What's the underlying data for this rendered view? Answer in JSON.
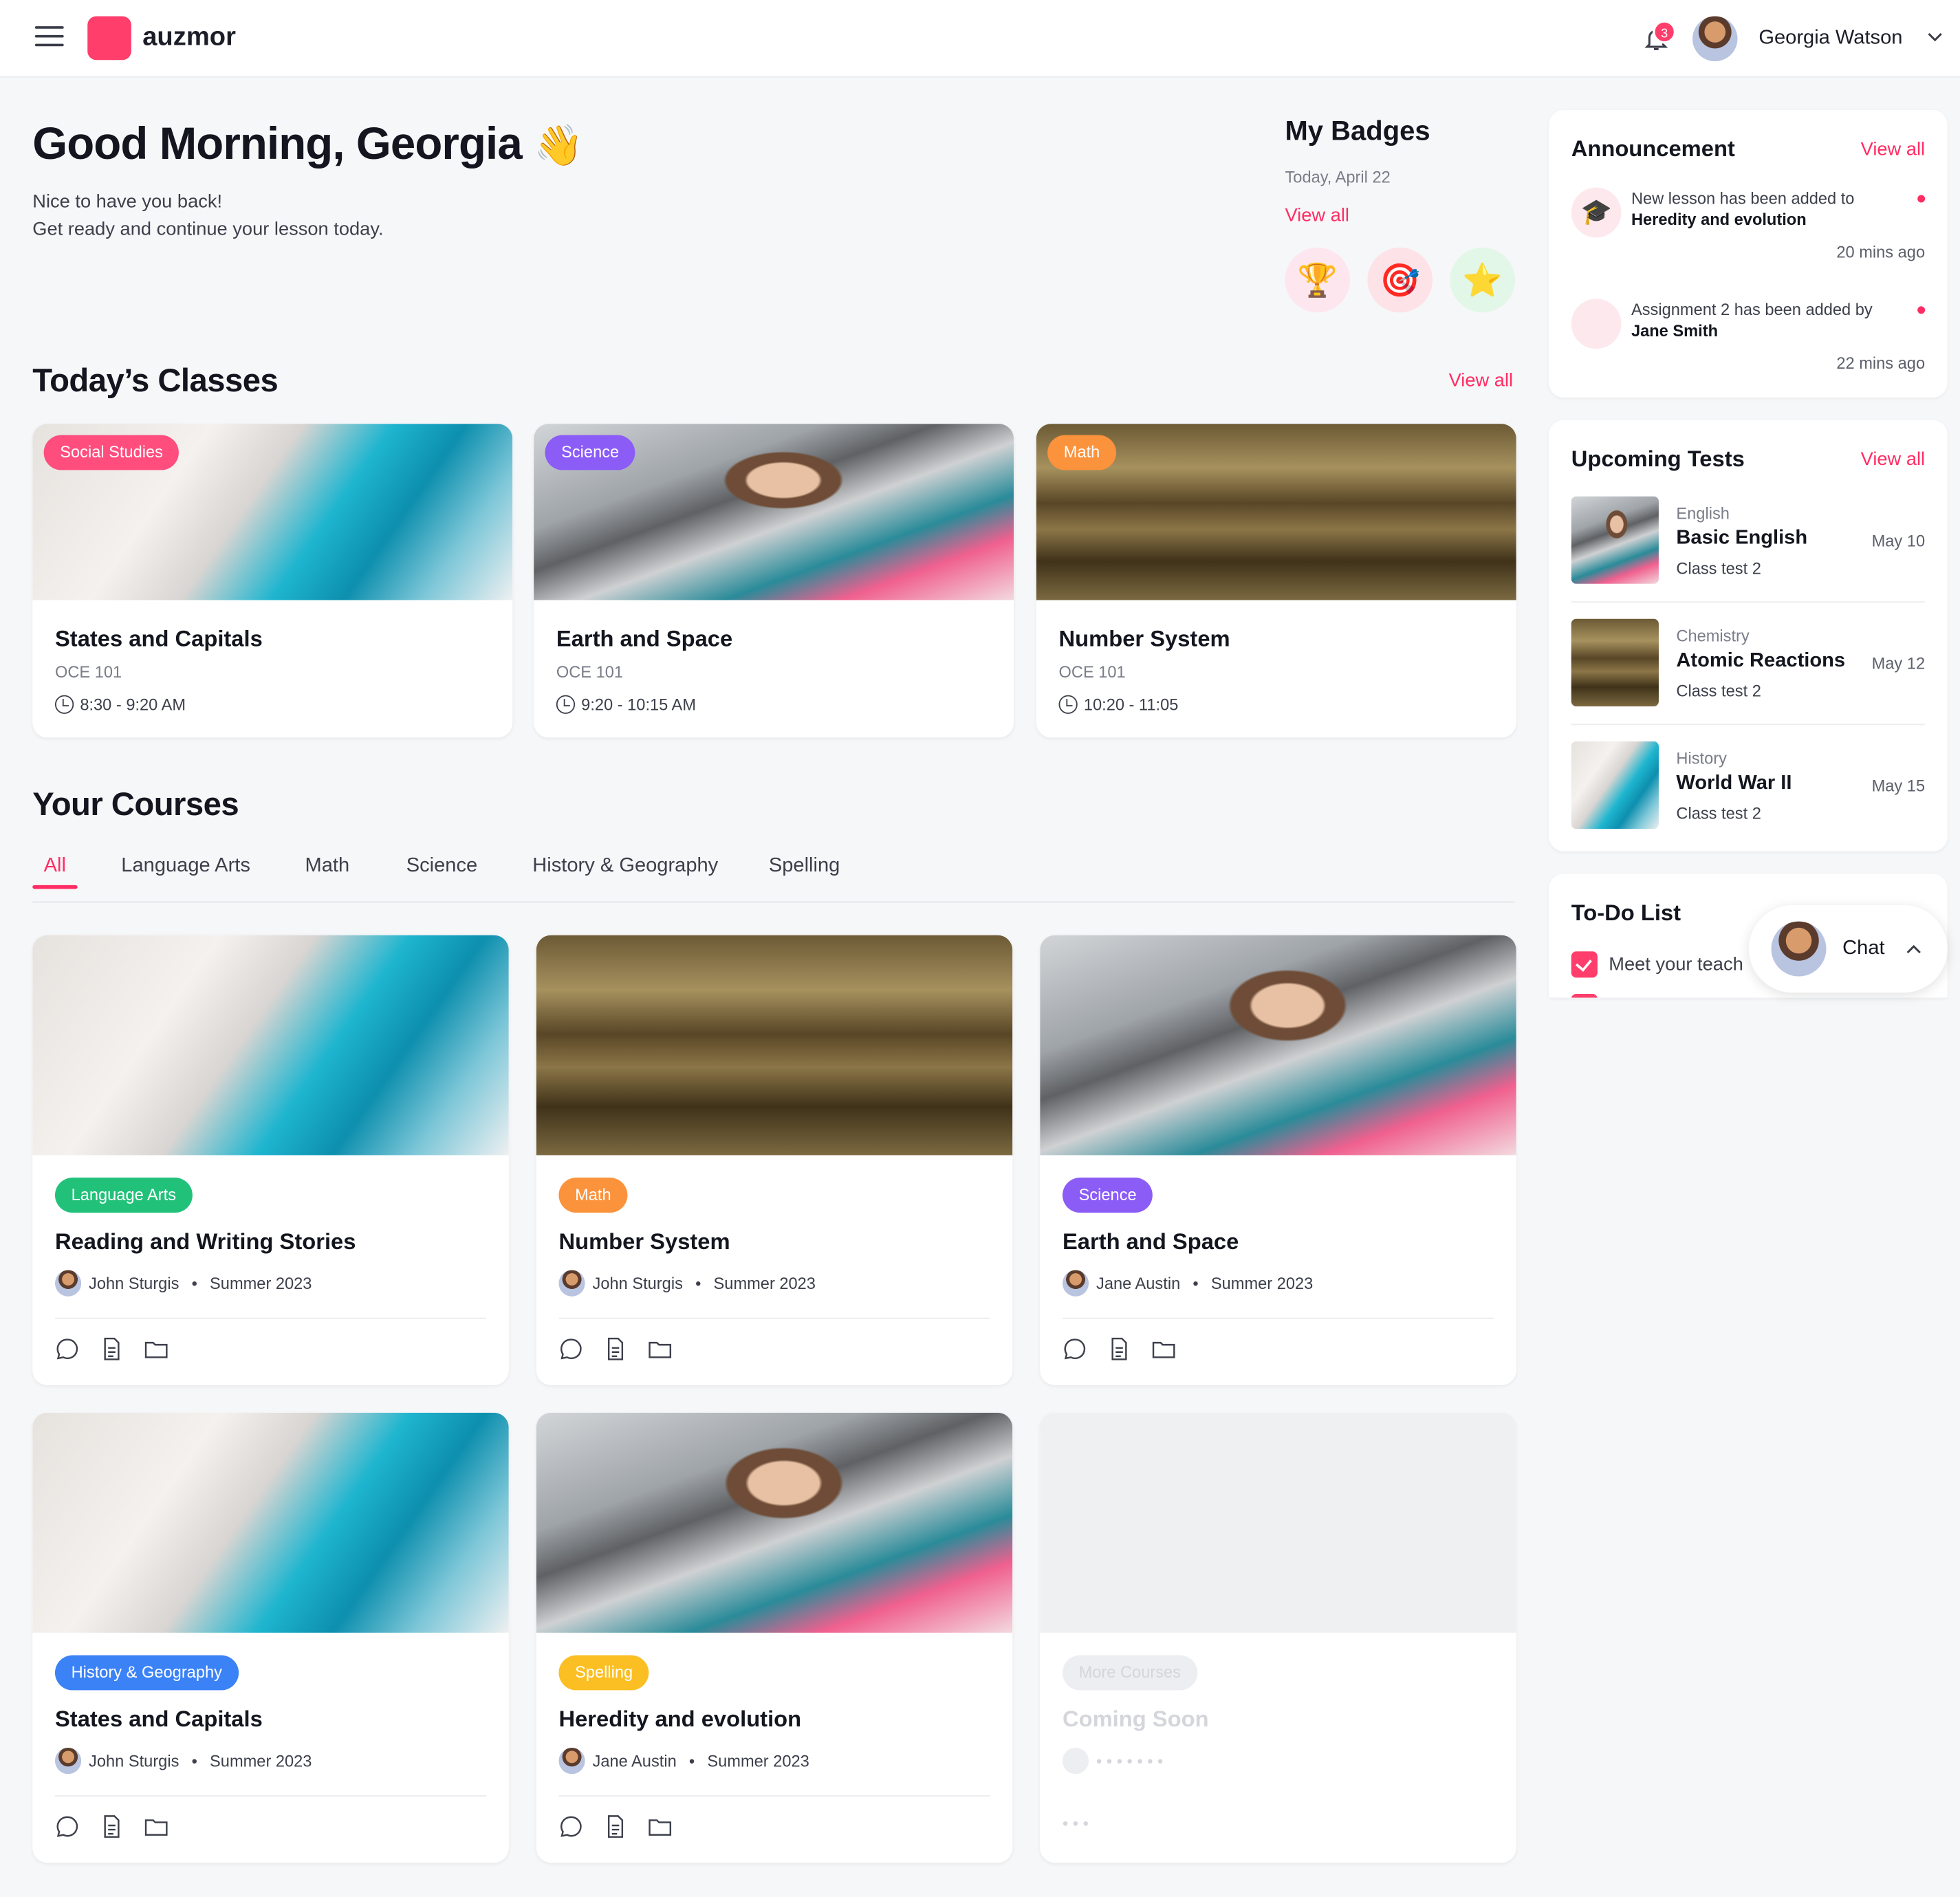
{
  "app": {
    "brand": "auzmor",
    "accent": "#ff2d63"
  },
  "header": {
    "notifications": "3",
    "user_name": "Georgia Watson",
    "icons": [
      "menu-icon",
      "bell-icon",
      "chevron-down-icon"
    ]
  },
  "greeting": {
    "title": "Good Morning, Georgia",
    "emoji": "👋",
    "line1": "Nice to have you back!",
    "line2": "Get ready and continue your lesson today."
  },
  "badges": {
    "title": "My Badges",
    "date": "Today, April 22",
    "view_all": "View all",
    "items": [
      "🏆",
      "🎯",
      "⭐"
    ]
  },
  "todays_classes": {
    "title": "Today’s Classes",
    "view_all": "View all",
    "items": [
      {
        "tag": "Social Studies",
        "tag_color": "#ff4d7e",
        "title": "States and Capitals",
        "code": "OCE 101",
        "time": "8:30 - 9:20 AM"
      },
      {
        "tag": "Science",
        "tag_color": "#8b5cf6",
        "title": "Earth and Space",
        "code": "OCE 101",
        "time": "9:20 - 10:15 AM"
      },
      {
        "tag": "Math",
        "tag_color": "#fb923c",
        "title": "Number System",
        "code": "OCE 101",
        "time": "10:20 - 11:05"
      }
    ]
  },
  "courses": {
    "title": "Your Courses",
    "tabs": [
      "All",
      "Language Arts",
      "Math",
      "Science",
      "History & Geography",
      "Spelling"
    ],
    "items": [
      {
        "tag": "Language Arts",
        "tag_color": "#22c17a",
        "title": "Reading and Writing Stories",
        "teacher": "John Sturgis",
        "term": "Summer 2023"
      },
      {
        "tag": "Math",
        "tag_color": "#fb923c",
        "title": "Number System",
        "teacher": "John Sturgis",
        "term": "Summer 2023"
      },
      {
        "tag": "Science",
        "tag_color": "#8b5cf6",
        "title": "Earth and Space",
        "teacher": "Jane Austin",
        "term": "Summer 2023"
      },
      {
        "tag": "History & Geography",
        "tag_color": "#3b82f6",
        "title": "States and Capitals",
        "teacher": "John Sturgis",
        "term": "Summer 2023"
      },
      {
        "tag": "Spelling",
        "tag_color": "#fbbf24",
        "title": "Heredity and evolution",
        "teacher": "Jane Austin",
        "term": "Summer 2023"
      }
    ],
    "placeholder": {
      "tag": "More Courses",
      "title": "Coming Soon",
      "meta": "• • •   •   • • •",
      "footer": "• • •"
    }
  },
  "announcement": {
    "title": "Announcement",
    "view_all": "View all",
    "items": [
      {
        "text": "New lesson has been added to",
        "strong": "Heredity and evolution",
        "time": "20 mins ago"
      },
      {
        "text": "Assignment 2 has been added by",
        "strong": "Jane Smith",
        "time": "22 mins ago"
      }
    ]
  },
  "upcoming_tests": {
    "title": "Upcoming Tests",
    "view_all": "View all",
    "items": [
      {
        "subject": "English",
        "name": "Basic English",
        "cls": "Class test 2",
        "date": "May 10"
      },
      {
        "subject": "Chemistry",
        "name": "Atomic Reactions",
        "cls": "Class test 2",
        "date": "May 12"
      },
      {
        "subject": "History",
        "name": "World War II",
        "cls": "Class test 2",
        "date": "May 15"
      }
    ]
  },
  "todo": {
    "title": "To-Do List",
    "first_item": "Meet your teach"
  },
  "chat": {
    "label": "Chat"
  }
}
